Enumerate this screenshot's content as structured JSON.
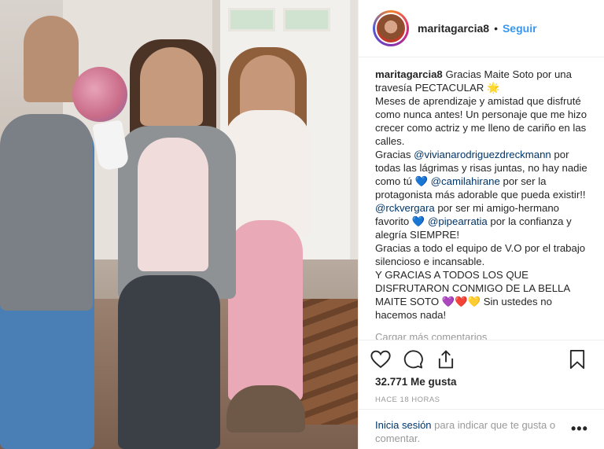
{
  "post": {
    "username": "maritagarcia8",
    "dot": "•",
    "follow_label": "Seguir",
    "caption": {
      "username": "maritagarcia8",
      "line1": " Gracias Maite Soto por una travesía PECTACULAR ",
      "emoji_star": "🌟",
      "line2": "Meses de aprendizaje y amistad que disfruté como nunca antes! Un personaje que me hizo crecer como actriz y me lleno de cariño en las calles.",
      "gracias_prefix": "Gracias ",
      "mention1": "@vivianarodriguezdreckmann",
      "text_after_mention1": " por todas las lágrimas y risas juntas, no hay nadie como tú ",
      "emoji_blue_heart": "💙",
      "mention2": "@camilahirane",
      "text_after_mention2": " por ser la protagonista más adorable que pueda existir!! ",
      "mention3": "@rckvergara",
      "text_after_mention3": " por ser mi amigo-hermano favorito ",
      "emoji_blue_heart2": "💙",
      "mention4": "@pipearratia",
      "text_after_mention4": " por la confianza y alegría SIEMPRE!",
      "line3": "Gracias a todo el equipo de V.O por el trabajo silencioso e incansable.",
      "line4_prefix": "Y GRACIAS A TODOS LOS QUE DISFRUTARON CONMIGO DE LA BELLA MAITE SOTO ",
      "emoji_hearts": "💜❤️💛",
      "line4_suffix": " Sin ustedes no hacemos nada!"
    },
    "more_comments": "Cargar más comentarios",
    "likes": "32.771 Me gusta",
    "time": "HACE 18 HORAS",
    "login": {
      "link": "Inicia sesión",
      "rest": " para indicar que te gusta o comentar.",
      "more": "•••"
    }
  },
  "icons": {
    "like": "heart-icon",
    "comment": "comment-icon",
    "share": "share-icon",
    "save": "bookmark-icon"
  },
  "colors": {
    "link": "#003569",
    "follow": "#3897f0",
    "muted": "#999999"
  }
}
